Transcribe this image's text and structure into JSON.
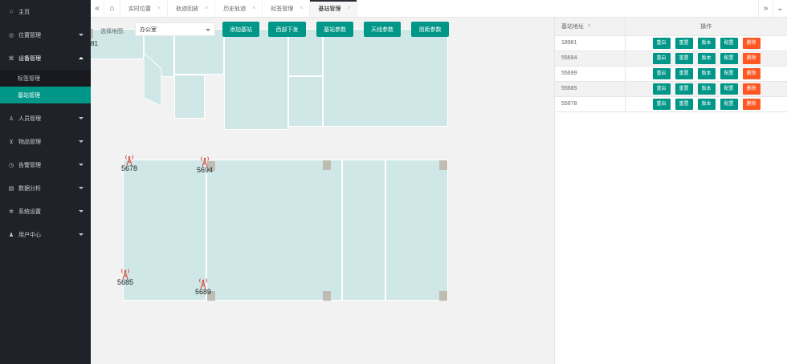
{
  "sidebar": {
    "items": [
      {
        "label": "主页",
        "icon": "home-icon",
        "glyph": "⌂"
      },
      {
        "label": "位置管理",
        "icon": "location-icon",
        "glyph": "◎",
        "arrow": true
      },
      {
        "label": "设备管理",
        "icon": "device-icon",
        "glyph": "⌘",
        "arrow": true,
        "open": true
      },
      {
        "label": "人员管理",
        "icon": "person-icon",
        "glyph": "♙",
        "arrow": true
      },
      {
        "label": "物品管理",
        "icon": "cart-icon",
        "glyph": "⊻",
        "arrow": true
      },
      {
        "label": "告警管理",
        "icon": "alarm-icon",
        "glyph": "◷",
        "arrow": true
      },
      {
        "label": "数据分析",
        "icon": "data-icon",
        "glyph": "▤",
        "arrow": true
      },
      {
        "label": "系统设置",
        "icon": "settings-icon",
        "glyph": "✲",
        "arrow": true
      },
      {
        "label": "用户中心",
        "icon": "user-icon",
        "glyph": "♟",
        "arrow": true
      }
    ],
    "sub_items": [
      "标签管理",
      "基站管理"
    ]
  },
  "tabs": {
    "items": [
      "实时位置",
      "轨迹回放",
      "历史轨迹",
      "标签管理",
      "基站管理"
    ],
    "active_index": 4,
    "close_glyph": "×",
    "left_glyph": "«",
    "home_glyph": "⌂",
    "right_glyph": "»",
    "menu_glyph": "⌄"
  },
  "map": {
    "select_label": "选择地图:",
    "select_value": "办公室",
    "buttons": [
      "添加基站",
      "西部下发",
      "基站参数",
      "天线参数",
      "测距参数"
    ],
    "edge_text": "81",
    "stations": [
      "5678",
      "5694",
      "5685",
      "5689"
    ]
  },
  "table": {
    "headers": [
      "基站地址",
      "操作"
    ],
    "sort_glyph": "⇕",
    "rows": [
      "18981",
      "55694",
      "55699",
      "55685",
      "55678"
    ],
    "actions": [
      "重启",
      "重置",
      "版本",
      "配置",
      "删除"
    ]
  },
  "colors": {
    "accent": "#009688",
    "danger": "#ff5722",
    "sidebar": "#20222a",
    "room": "#cfe8e7",
    "pillar": "#c0bcb2",
    "antenna": "#d9534f"
  }
}
